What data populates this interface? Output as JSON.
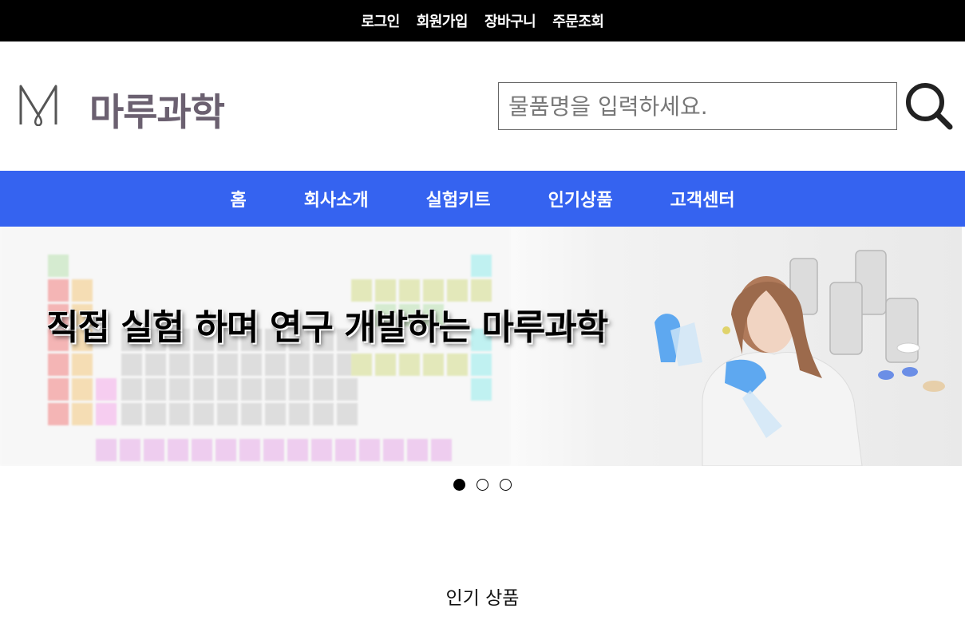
{
  "topbar": {
    "links": [
      "로그인",
      "회원가입",
      "장바구니",
      "주문조회"
    ]
  },
  "header": {
    "logo_text": "마루과학",
    "search_placeholder": "물품명을 입력하세요.",
    "search_icon": "search-icon"
  },
  "nav": {
    "items": [
      "홈",
      "회사소개",
      "실험키트",
      "인기상품",
      "고객센터"
    ]
  },
  "banner": {
    "caption": "직접 실험 하며 연구 개발하는 마루과학",
    "slide_count": 3,
    "active_slide": 1
  },
  "section": {
    "title": "인기 상품"
  },
  "colors": {
    "topbar_bg": "#000000",
    "nav_bg": "#3563f0",
    "logo_text": "#6b6070"
  }
}
